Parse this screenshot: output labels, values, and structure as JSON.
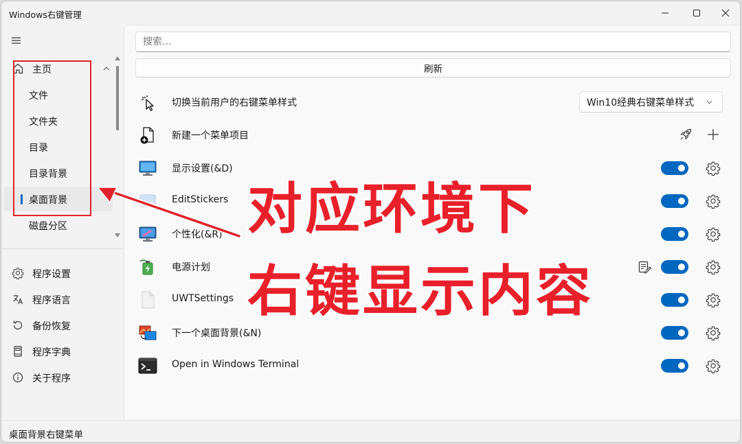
{
  "window": {
    "title": "Windows右键管理"
  },
  "sidebar": {
    "main": {
      "label": "主页"
    },
    "sub_items": [
      {
        "label": "文件"
      },
      {
        "label": "文件夹"
      },
      {
        "label": "目录"
      },
      {
        "label": "目录背景"
      },
      {
        "label": "桌面背景",
        "selected": true
      },
      {
        "label": "磁盘分区"
      }
    ],
    "bottom_items": [
      {
        "label": "程序设置",
        "icon": "gear-icon"
      },
      {
        "label": "程序语言",
        "icon": "translate-icon"
      },
      {
        "label": "备份恢复",
        "icon": "restore-icon"
      },
      {
        "label": "程序字典",
        "icon": "book-icon"
      },
      {
        "label": "关于程序",
        "icon": "info-icon"
      }
    ]
  },
  "main": {
    "search_placeholder": "搜索...",
    "refresh_label": "刷新",
    "style_row": {
      "label": "切换当前用户的右键菜单样式",
      "dropdown_value": "Win10经典右键菜单样式"
    },
    "new_item_row": {
      "label": "新建一个菜单项目"
    },
    "items": [
      {
        "label": "显示设置(&D)",
        "icon": "display-icon",
        "enabled": true
      },
      {
        "label": "EditStickers",
        "icon": "stickers-icon",
        "enabled": true
      },
      {
        "label": "个性化(&R)",
        "icon": "personalize-icon",
        "enabled": true
      },
      {
        "label": "电源计划",
        "icon": "power-plan-icon",
        "enabled": true
      },
      {
        "label": "UWTSettings",
        "icon": "blank-file-icon",
        "enabled": true
      },
      {
        "label": "下一个桌面背景(&N)",
        "icon": "next-background-icon",
        "enabled": true
      },
      {
        "label": "Open in Windows Terminal",
        "icon": "terminal-icon",
        "enabled": true
      }
    ]
  },
  "overlay": {
    "line1": "对应环境下",
    "line2": "右键显示内容"
  },
  "status": {
    "text": "桌面背景右键菜单"
  },
  "colors": {
    "accent": "#0067c0",
    "annotation": "#e8202a"
  }
}
